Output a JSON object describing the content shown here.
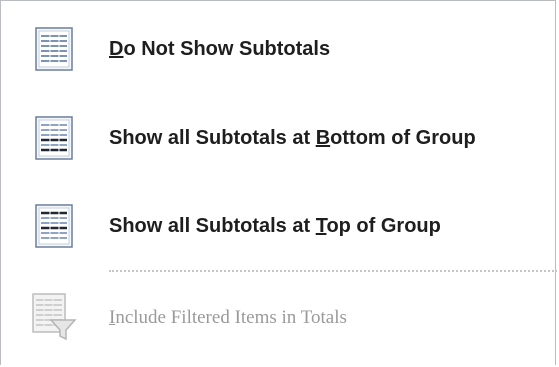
{
  "menu": {
    "items": [
      {
        "pre": "",
        "mnemonic": "D",
        "post": "o Not Show Subtotals",
        "icon": "no-subtotals-icon",
        "enabled": true
      },
      {
        "pre": "Show all Subtotals at ",
        "mnemonic": "B",
        "post": "ottom of Group",
        "icon": "subtotals-bottom-icon",
        "enabled": true
      },
      {
        "pre": "Show all Subtotals at ",
        "mnemonic": "T",
        "post": "op of Group",
        "icon": "subtotals-top-icon",
        "enabled": true
      },
      {
        "pre": "",
        "mnemonic": "I",
        "post": "nclude Filtered Items in Totals",
        "icon": "filtered-totals-icon",
        "enabled": false
      }
    ]
  },
  "colors": {
    "text": "#1e1e1e",
    "disabled_text": "#9a9a9a",
    "border": "#b9bcc0",
    "icon_frame": "#6c7f9a"
  }
}
